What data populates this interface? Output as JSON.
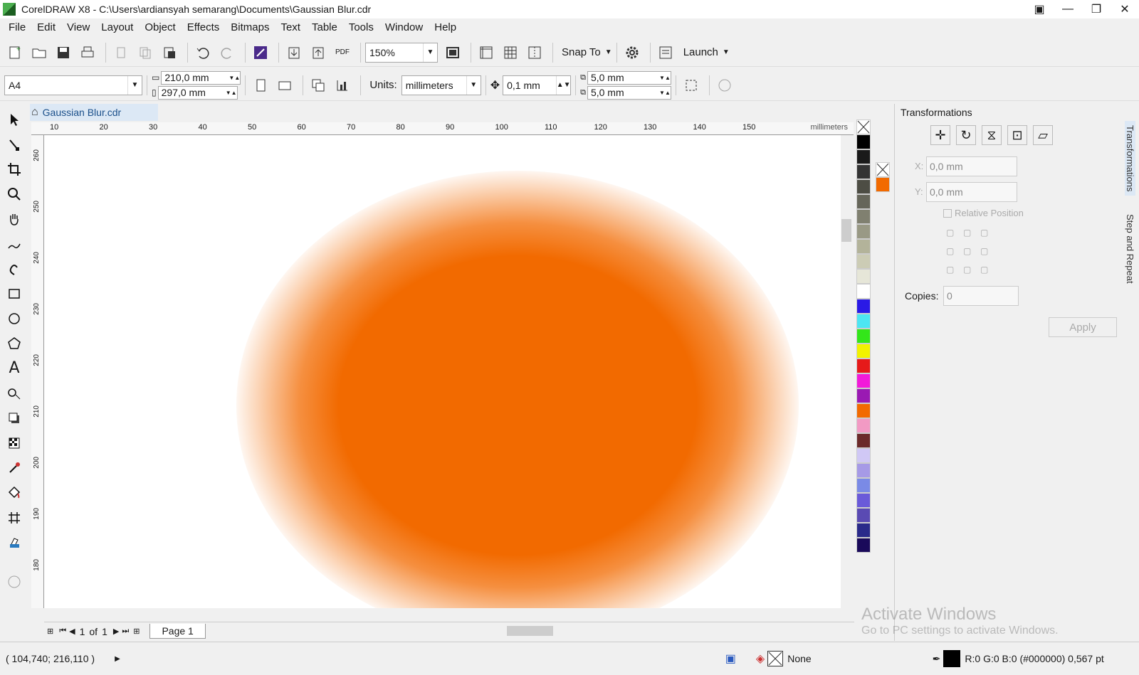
{
  "window": {
    "title": "CorelDRAW X8 - C:\\Users\\ardiansyah semarang\\Documents\\Gaussian Blur.cdr",
    "minimize": "—",
    "restore": "❐",
    "close": "✕"
  },
  "menu": [
    "File",
    "Edit",
    "View",
    "Layout",
    "Object",
    "Effects",
    "Bitmaps",
    "Text",
    "Table",
    "Tools",
    "Window",
    "Help"
  ],
  "toolbar": {
    "zoom": "150%",
    "snap_to": "Snap To",
    "launch": "Launch",
    "pdf": "PDF"
  },
  "property_bar": {
    "page_size": "A4",
    "width": "210,0 mm",
    "height": "297,0 mm",
    "units_label": "Units:",
    "units_value": "millimeters",
    "nudge": "0,1 mm",
    "dup_x": "5,0 mm",
    "dup_y": "5,0 mm"
  },
  "document": {
    "tab_name": "Gaussian Blur.cdr",
    "ruler_unit": "millimeters",
    "ruler_h_ticks": [
      "10",
      "20",
      "30",
      "40",
      "50",
      "60",
      "70",
      "80",
      "90",
      "100",
      "110",
      "120",
      "130",
      "140",
      "150"
    ],
    "ruler_v_ticks": [
      "260",
      "250",
      "240",
      "230",
      "220",
      "210",
      "200",
      "190",
      "180"
    ],
    "object_color": "#f26a00"
  },
  "page_nav": {
    "current": "1",
    "of": "of",
    "total": "1",
    "page_tab": "Page 1"
  },
  "palette": [
    "#000000",
    "#1a1a1a",
    "#333333",
    "#4d4d44",
    "#66665a",
    "#808070",
    "#999985",
    "#b3b39a",
    "#ccccb5",
    "#e6e6d8",
    "#ffffff",
    "#2a1ae6",
    "#4de6f2",
    "#33e61a",
    "#f2f200",
    "#e61a1a",
    "#f21ad9",
    "#9a1ab3",
    "#f26a00",
    "#f29ac4",
    "#6b2a2a",
    "#d0c8f5",
    "#a69ae6",
    "#7a8ae6",
    "#6a5ad9",
    "#5a4ab3",
    "#2a2a8a",
    "#1a0a5a"
  ],
  "docker": {
    "title": "Transformations",
    "x_label": "X:",
    "x_value": "0,0 mm",
    "y_label": "Y:",
    "y_value": "0,0 mm",
    "relative_position": "Relative Position",
    "copies_label": "Copies:",
    "copies_value": "0",
    "apply": "Apply",
    "side_tab_1": "Transformations",
    "side_tab_2": "Step and Repeat"
  },
  "status": {
    "cursor_pos": "( 104,740; 216,110 )",
    "fill_none": "None",
    "outline_info": "R:0 G:0 B:0 (#000000)  0,567 pt"
  },
  "watermark": {
    "line1": "Activate Windows",
    "line2": "Go to PC settings to activate Windows."
  }
}
